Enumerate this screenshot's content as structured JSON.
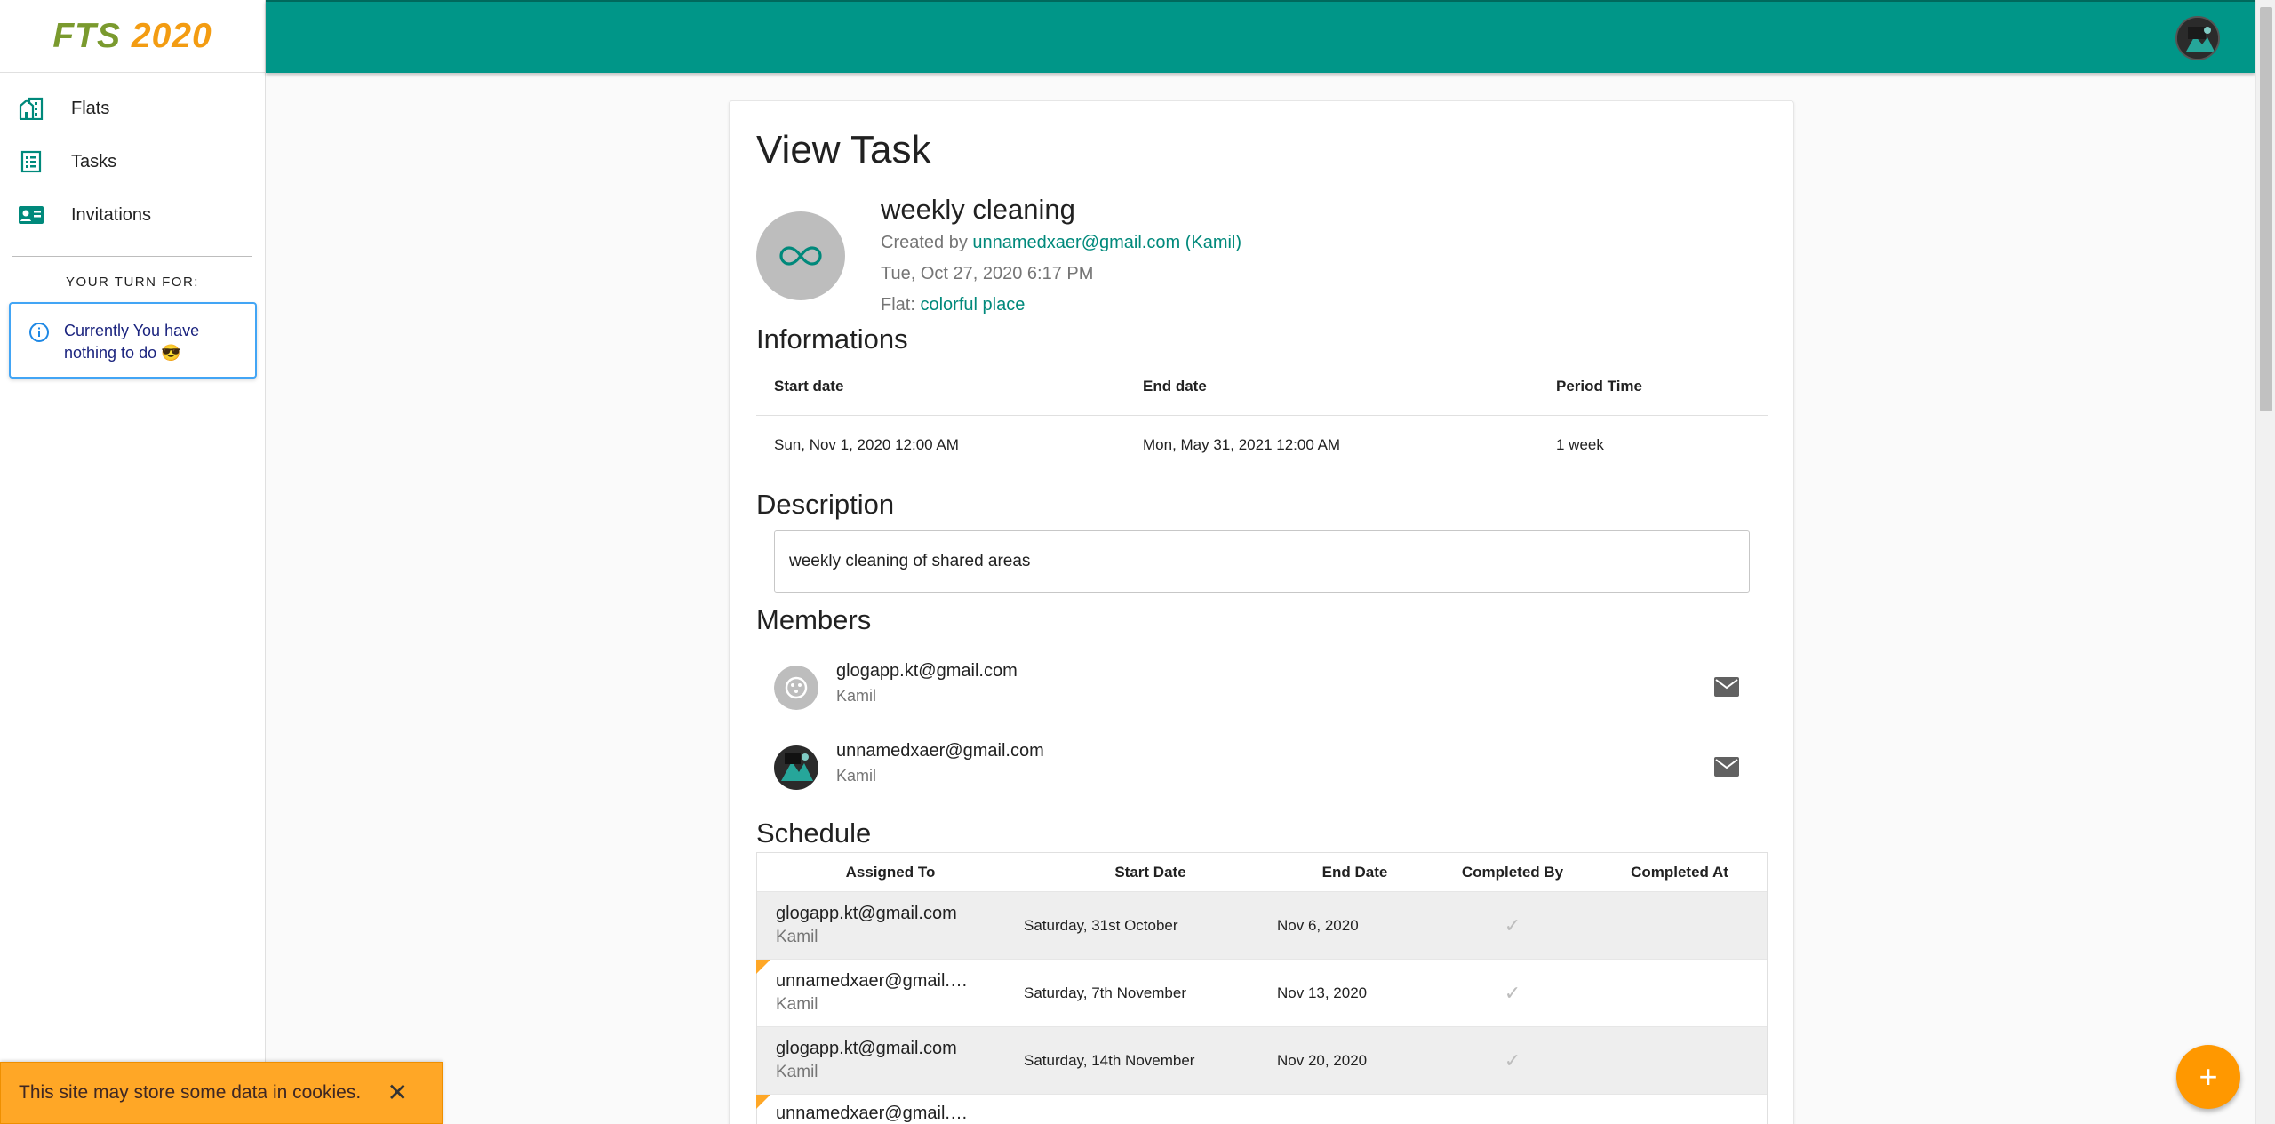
{
  "brand": {
    "part1": "FTS",
    "part2": "2020"
  },
  "sidebar": {
    "items": [
      {
        "label": "Flats",
        "icon": "building-icon"
      },
      {
        "label": "Tasks",
        "icon": "list-icon"
      },
      {
        "label": "Invitations",
        "icon": "id-card-icon"
      }
    ],
    "turn_title": "YOUR TURN FOR:",
    "info_text": "Currently You have nothing to do 😎"
  },
  "colors": {
    "primary": "#009688",
    "accent": "#ff9800",
    "link": "#00897b",
    "cookie": "#ffa726"
  },
  "task": {
    "page_title": "View Task",
    "name": "weekly cleaning",
    "created_by_label": "Created by",
    "creator": "unnamedxaer@gmail.com (Kamil)",
    "created_at": "Tue, Oct 27, 2020 6:17 PM",
    "flat_label": "Flat:",
    "flat": "colorful place"
  },
  "informations": {
    "heading": "Informations",
    "headers": [
      "Start date",
      "End date",
      "Period Time"
    ],
    "values": [
      "Sun, Nov 1, 2020 12:00 AM",
      "Mon, May 31, 2021 12:00 AM",
      "1 week"
    ]
  },
  "description": {
    "heading": "Description",
    "text": "weekly cleaning of shared areas"
  },
  "members": {
    "heading": "Members",
    "list": [
      {
        "email": "glogapp.kt@gmail.com",
        "name": "Kamil"
      },
      {
        "email": "unnamedxaer@gmail.com",
        "name": "Kamil"
      }
    ]
  },
  "schedule": {
    "heading": "Schedule",
    "headers": [
      "Assigned To",
      "Start Date",
      "End Date",
      "Completed By",
      "Completed At"
    ],
    "rows": [
      {
        "email": "glogapp.kt@gmail.com",
        "name": "Kamil",
        "start": "Saturday, 31st October",
        "end": "Nov 6, 2020"
      },
      {
        "email": "unnamedxaer@gmail.com",
        "name": "Kamil",
        "start": "Saturday, 7th November",
        "end": "Nov 13, 2020"
      },
      {
        "email": "glogapp.kt@gmail.com",
        "name": "Kamil",
        "start": "Saturday, 14th November",
        "end": "Nov 20, 2020"
      },
      {
        "email": "unnamedxaer@gmail.com",
        "name": "",
        "start": "",
        "end": ""
      }
    ]
  },
  "cookie": {
    "text": "This site may store some data in cookies."
  },
  "fab": {
    "label": "+"
  }
}
